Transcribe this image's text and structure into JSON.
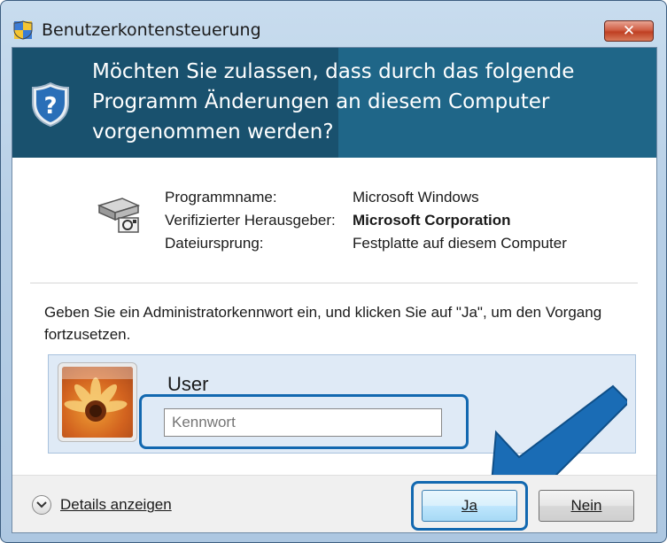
{
  "window": {
    "title": "Benutzerkontensteuerung",
    "close_glyph": "✕"
  },
  "banner": {
    "question": "Möchten Sie zulassen, dass durch das folgende Programm Änderungen an diesem Computer vorgenommen werden?",
    "icon": "shield-question-icon"
  },
  "program": {
    "icon": "program-drive-icon",
    "rows": [
      {
        "label": "Programmname:",
        "value": "Microsoft Windows",
        "bold": false
      },
      {
        "label": "Verifizierter Herausgeber:",
        "value": "Microsoft Corporation",
        "bold": true
      },
      {
        "label": "Dateiursprung:",
        "value": "Festplatte auf diesem Computer",
        "bold": false
      }
    ]
  },
  "instruction": "Geben Sie ein Administratorkennwort ein, und klicken Sie auf \"Ja\", um den Vorgang fortzusetzen.",
  "credential": {
    "user_name": "User",
    "password_placeholder": "Kennwort",
    "avatar": "flower-avatar"
  },
  "footer": {
    "details_label": "Details anzeigen",
    "yes_label": "Ja",
    "no_label": "Nein"
  },
  "colors": {
    "banner": "#19516e",
    "highlight": "#1268b0",
    "arrow": "#1a6cb5"
  }
}
